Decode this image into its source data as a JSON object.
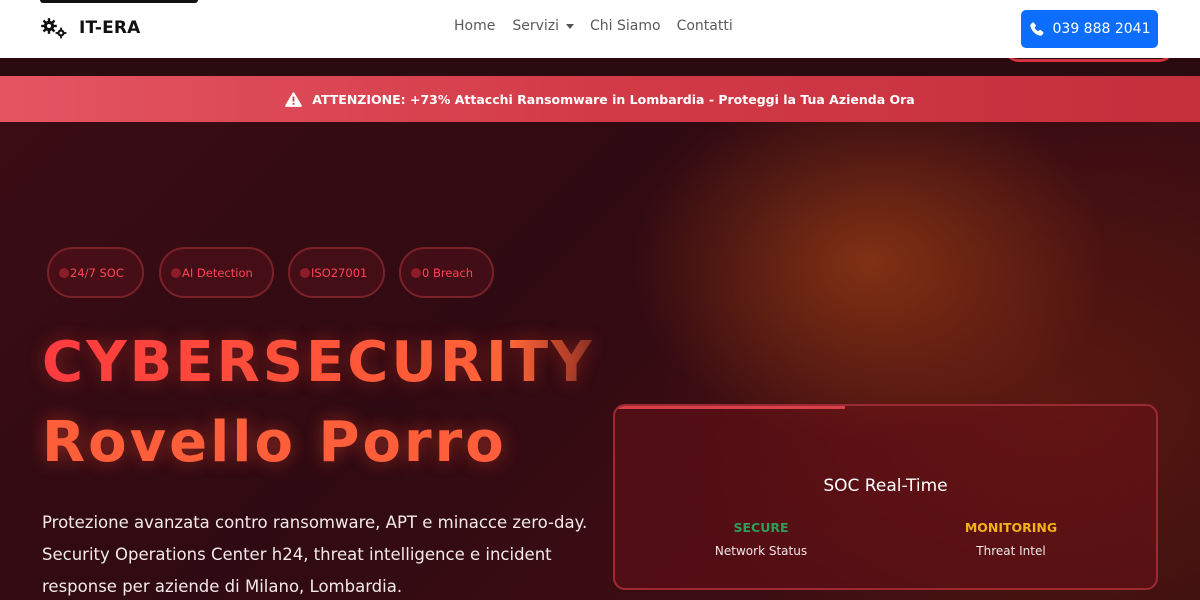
{
  "navbar": {
    "brand": "IT-ERA",
    "brand_icon": "gears-icon",
    "links": [
      {
        "label": "Home"
      },
      {
        "label": "Servizi",
        "has_dropdown": true
      },
      {
        "label": "Chi Siamo"
      },
      {
        "label": "Contatti"
      }
    ],
    "phone_label": "039 888 2041",
    "phone_icon": "phone-icon",
    "phone_button_color": "#0d6efd"
  },
  "alert": {
    "icon": "warning-triangle-icon",
    "text": "ATTENZIONE: +73% Attacchi Ransomware in Lombardia - Proteggi la Tua Azienda Ora",
    "color": "#d33a47"
  },
  "hero": {
    "badges": [
      "24/7 SOC",
      "AI Detection",
      "ISO27001",
      "0 Breach"
    ],
    "title_line1": "CYBERSECURITY",
    "title_line2": "Rovello Porro",
    "description": "Protezione avanzata contro ransomware, APT e minacce zero-day. Security Operations Center h24, threat intelligence e incident response per aziende di Milano, Lombardia.",
    "accent_color": "#ff5e3a"
  },
  "soc_card": {
    "title": "SOC Real-Time",
    "stats": [
      {
        "value": "SECURE",
        "label": "Network Status",
        "color": "#2e9e5a"
      },
      {
        "value": "MONITORING",
        "label": "Threat Intel",
        "color": "#f3b21a"
      }
    ]
  }
}
